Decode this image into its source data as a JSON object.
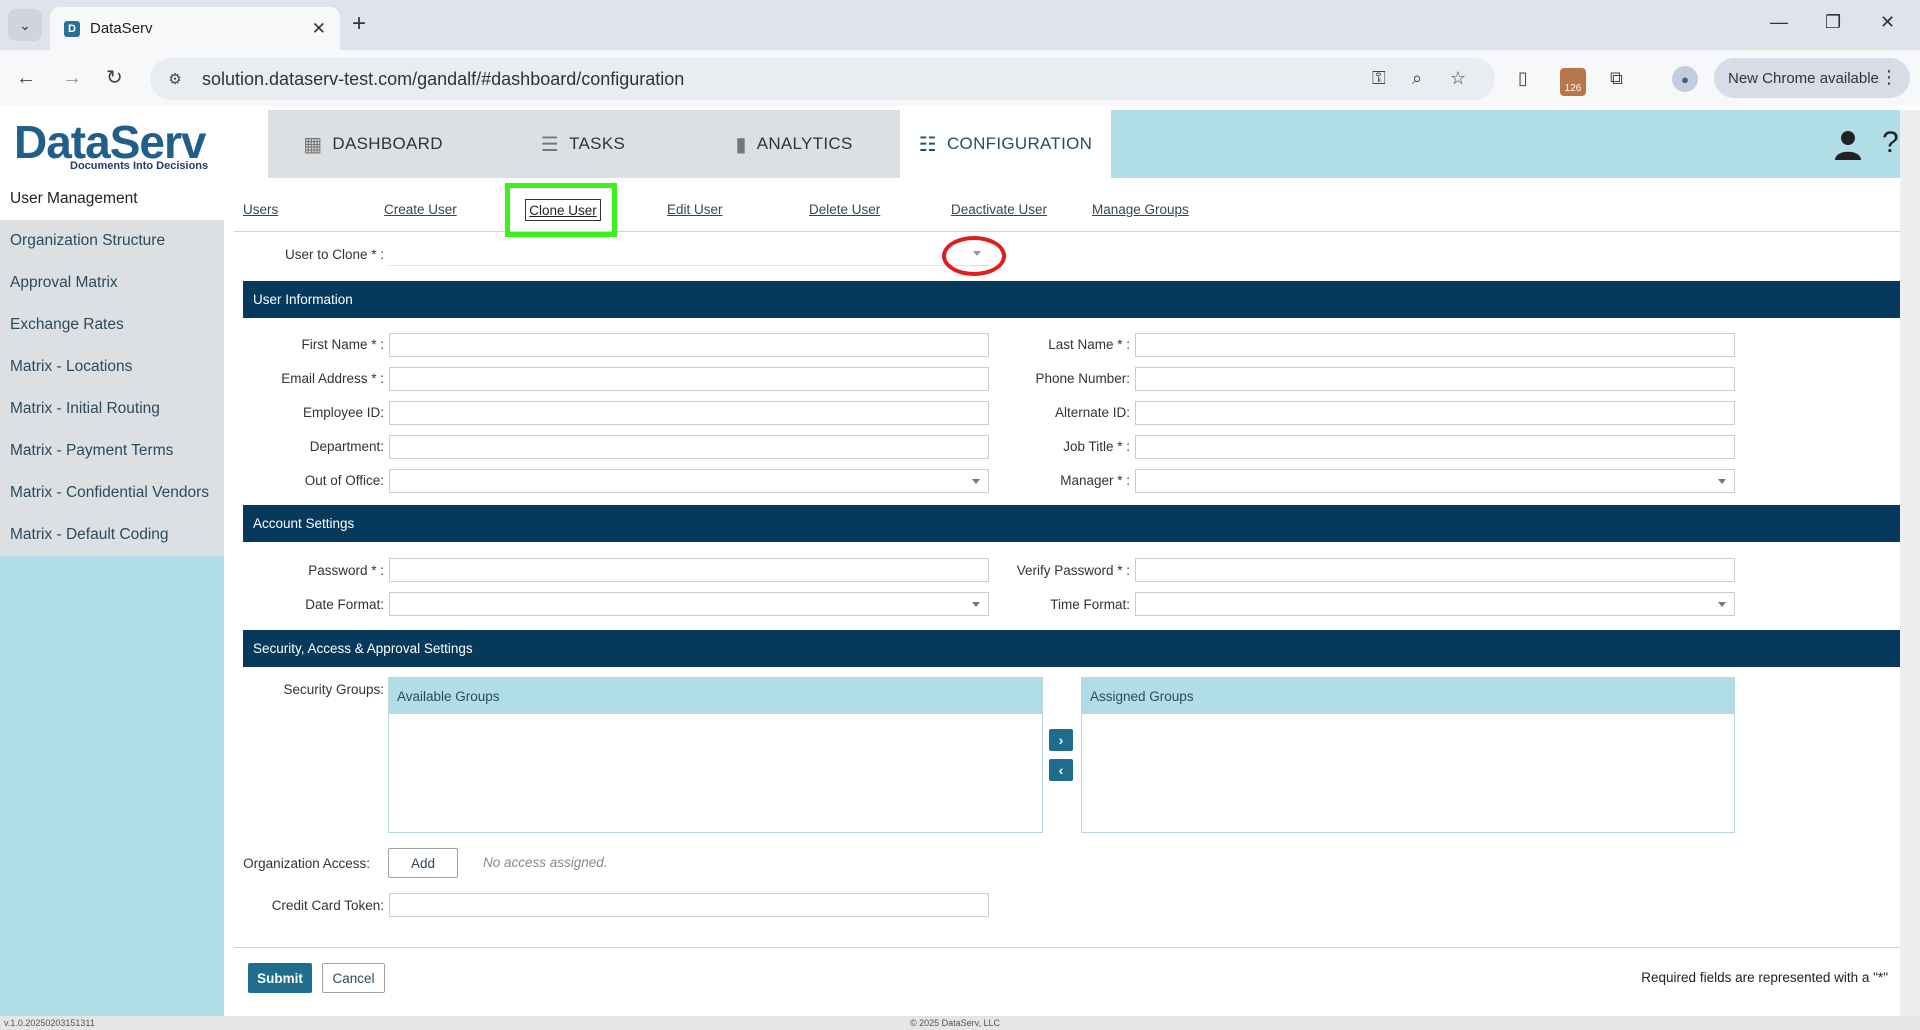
{
  "browser": {
    "tab_title": "DataServ",
    "url": "solution.dataserv-test.com/gandalf/#dashboard/configuration",
    "update_chip": "New Chrome available",
    "extension_badge": "126"
  },
  "app": {
    "logo_text": "DataServ",
    "logo_tagline": "Documents Into Decisions",
    "nav": [
      {
        "label": "DASHBOARD"
      },
      {
        "label": "TASKS"
      },
      {
        "label": "ANALYTICS"
      },
      {
        "label": "CONFIGURATION"
      }
    ],
    "help_label": "?"
  },
  "sidebar": {
    "items": [
      {
        "label": "User Management"
      },
      {
        "label": "Organization Structure"
      },
      {
        "label": "Approval Matrix"
      },
      {
        "label": "Exchange Rates"
      },
      {
        "label": "Matrix - Locations"
      },
      {
        "label": "Matrix - Initial Routing"
      },
      {
        "label": "Matrix - Payment Terms"
      },
      {
        "label": "Matrix - Confidential Vendors"
      },
      {
        "label": "Matrix - Default Coding"
      }
    ]
  },
  "subnav": {
    "users": "Users",
    "create_user": "Create User",
    "clone_user": "Clone User",
    "edit_user": "Edit User",
    "delete_user": "Delete User",
    "deactivate_user": "Deactivate User",
    "manage_groups": "Manage Groups"
  },
  "form": {
    "user_to_clone_label": "User to Clone * :",
    "sections": {
      "user_info": "User Information",
      "account": "Account Settings",
      "security": "Security, Access & Approval Settings"
    },
    "labels": {
      "first_name": "First Name * :",
      "last_name": "Last Name * :",
      "email": "Email Address * :",
      "phone": "Phone Number:",
      "employee_id": "Employee ID:",
      "alternate_id": "Alternate ID:",
      "department": "Department:",
      "job_title": "Job Title * :",
      "out_of_office": "Out of Office:",
      "manager": "Manager * :",
      "password": "Password * :",
      "verify_password": "Verify Password * :",
      "date_format": "Date Format:",
      "time_format": "Time Format:",
      "security_groups": "Security Groups:",
      "org_access": "Organization Access:",
      "cc_token": "Credit Card Token:"
    },
    "available_groups": "Available Groups",
    "assigned_groups": "Assigned Groups",
    "add_label": "Add",
    "no_access": "No access assigned.",
    "submit_label": "Submit",
    "cancel_label": "Cancel",
    "required_note": "Required fields are represented with a \"*\""
  },
  "status": {
    "version": "v.1.0.20250203151311",
    "copyright": "© 2025 DataServ, LLC"
  }
}
